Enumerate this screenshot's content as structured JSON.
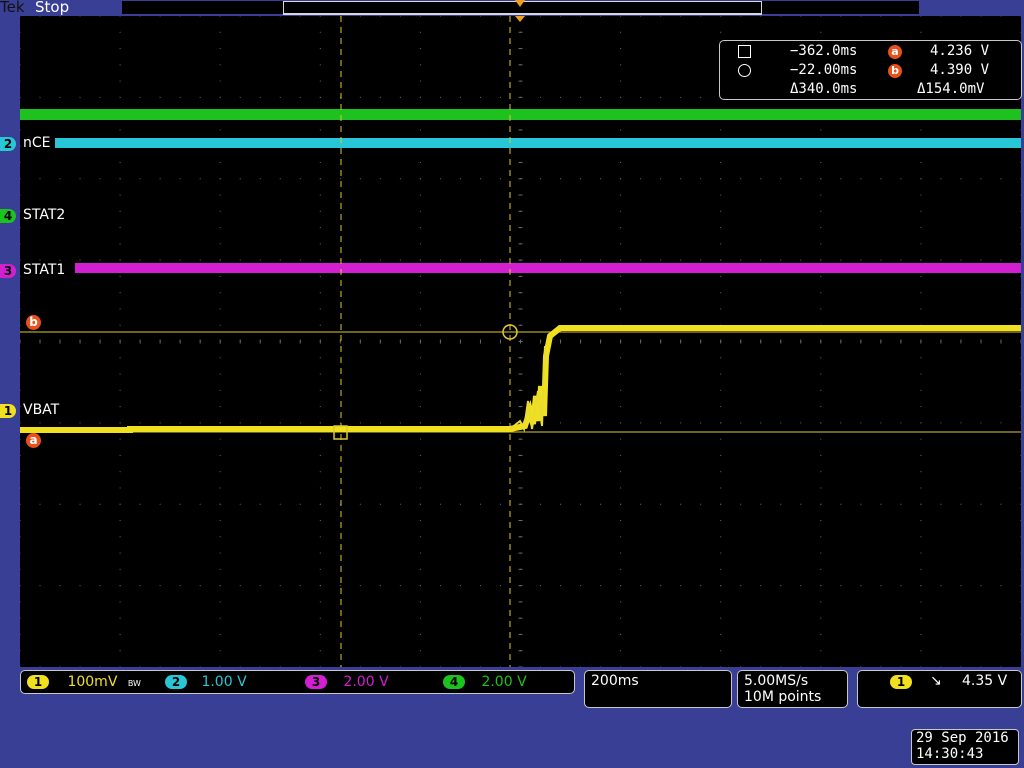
{
  "header": {
    "brand": "Tek",
    "acq_status": "Stop"
  },
  "channels": [
    {
      "number": "2",
      "label": "nCE",
      "color": "#27c7d8"
    },
    {
      "number": "4",
      "label": "STAT2",
      "color": "#1ec21e"
    },
    {
      "number": "3",
      "label": "STAT1",
      "color": "#d21fd2"
    },
    {
      "number": "1",
      "label": "VBAT",
      "color": "#f0e020"
    }
  ],
  "cursor_markers": {
    "a": "a",
    "b": "b"
  },
  "cursor_readout": {
    "row1": {
      "time": "−362.0ms",
      "badge": "a",
      "volt": "4.236 V"
    },
    "row2": {
      "time": "−22.00ms",
      "badge": "b",
      "volt": "4.390 V"
    },
    "row3": {
      "dtime": "Δ340.0ms",
      "dvolt": "Δ154.0mV"
    }
  },
  "vertical_settings": [
    {
      "ch": "1",
      "value": "100mV",
      "color": "#f0e020",
      "bw": "BW"
    },
    {
      "ch": "2",
      "value": "1.00 V",
      "color": "#27c7d8"
    },
    {
      "ch": "3",
      "value": "2.00 V",
      "color": "#d21fd2"
    },
    {
      "ch": "4",
      "value": "2.00 V",
      "color": "#1ec21e"
    }
  ],
  "horizontal": {
    "scale": "200ms"
  },
  "acquisition": {
    "rate": "5.00MS/s",
    "points": "10M points"
  },
  "trigger": {
    "source": "1",
    "slope": "↘",
    "level": "4.35 V"
  },
  "datetime": {
    "date": "29 Sep  2016",
    "time": "14:30:43"
  },
  "colors": {
    "grid": "#6a6a6a",
    "cursor": "#e0c830",
    "frame": "#3a3f96",
    "marker": "#e8501e"
  }
}
